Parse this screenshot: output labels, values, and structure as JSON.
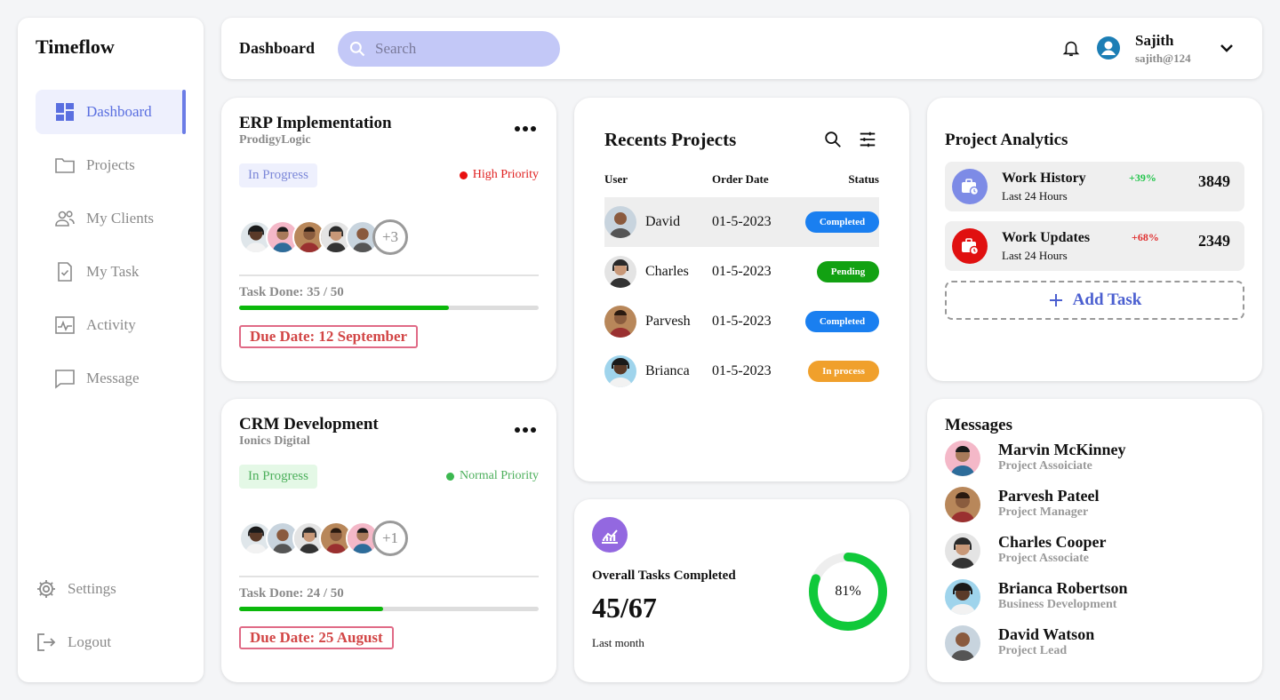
{
  "brand": "Timeflow",
  "sidebar": {
    "items": [
      {
        "label": "Dashboard",
        "icon": "dashboard-grid-icon"
      },
      {
        "label": "Projects",
        "icon": "folder-icon"
      },
      {
        "label": "My Clients",
        "icon": "users-icon"
      },
      {
        "label": "My Task",
        "icon": "task-check-icon"
      },
      {
        "label": "Activity",
        "icon": "activity-chart-icon"
      },
      {
        "label": "Message",
        "icon": "message-icon"
      }
    ],
    "settings": "Settings",
    "logout": "Logout"
  },
  "header": {
    "title": "Dashboard",
    "search_placeholder": "Search",
    "user_name": "Sajith",
    "user_email": "sajith@124"
  },
  "projects": [
    {
      "title": "ERP Implementation",
      "company": "ProdigyLogic",
      "status": "In Progress",
      "priority": "High Priority",
      "extra_members": "+3",
      "task_done": "Task Done: 35 / 50",
      "progress": 0.7,
      "due": "Due Date: 12 September"
    },
    {
      "title": "CRM Development",
      "company": "Ionics Digital",
      "status": "In Progress",
      "priority": "Normal Priority",
      "extra_members": "+1",
      "task_done": "Task Done: 24 / 50",
      "progress": 0.48,
      "due": "Due Date: 25 August"
    }
  ],
  "recent": {
    "title": "Recents Projects",
    "columns": [
      "User",
      "Order Date",
      "Status"
    ],
    "rows": [
      {
        "user": "David",
        "date": "01-5-2023",
        "status": "Completed",
        "color": "#1a7ff0"
      },
      {
        "user": "Charles",
        "date": "01-5-2023",
        "status": "Pending",
        "color": "#12a112"
      },
      {
        "user": "Parvesh",
        "date": "01-5-2023",
        "status": "Completed",
        "color": "#1a7ff0"
      },
      {
        "user": "Brianca",
        "date": "01-5-2023",
        "status": "In process",
        "color": "#f0a02c"
      }
    ]
  },
  "overall": {
    "label": "Overall Tasks Completed",
    "value": "45/67",
    "sub": "Last month",
    "percent_label": "81%",
    "percent": 81
  },
  "analytics": {
    "title": "Project Analytics",
    "items": [
      {
        "name": "Work History",
        "sub": "Last 24 Hours",
        "pct": "+39%",
        "value": "3849",
        "pct_color": "#21c44a",
        "icon_bg": "#7d8be6"
      },
      {
        "name": "Work Updates",
        "sub": "Last 24 Hours",
        "pct": "+68%",
        "value": "2349",
        "pct_color": "#e03030",
        "icon_bg": "#e01010"
      }
    ],
    "add_task": "Add Task"
  },
  "messages": {
    "title": "Messages",
    "items": [
      {
        "name": "Marvin McKinney",
        "role": "Project Assoiciate"
      },
      {
        "name": "Parvesh Pateel",
        "role": "Project Manager"
      },
      {
        "name": "Charles Cooper",
        "role": "Project Associate"
      },
      {
        "name": "Brianca Robertson",
        "role": "Business Development"
      },
      {
        "name": "David Watson",
        "role": "Project Lead"
      }
    ]
  }
}
